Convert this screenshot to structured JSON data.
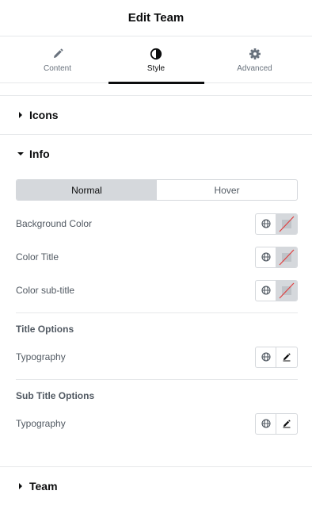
{
  "header": {
    "title": "Edit Team"
  },
  "tabs": [
    {
      "label": "Content",
      "icon": "pencil-icon",
      "active": false
    },
    {
      "label": "Style",
      "icon": "contrast-icon",
      "active": true
    },
    {
      "label": "Advanced",
      "icon": "gear-icon",
      "active": false
    }
  ],
  "sections": {
    "icons": {
      "title": "Icons",
      "expanded": false
    },
    "info": {
      "title": "Info",
      "expanded": true
    },
    "team": {
      "title": "Team",
      "expanded": false
    }
  },
  "state_toggle": {
    "normal": "Normal",
    "hover": "Hover",
    "selected": "Normal"
  },
  "colors": [
    {
      "label": "Background Color",
      "value": ""
    },
    {
      "label": "Color Title",
      "value": ""
    },
    {
      "label": "Color sub-title",
      "value": ""
    }
  ],
  "title_options": {
    "heading": "Title Options",
    "typography_label": "Typography"
  },
  "subtitle_options": {
    "heading": "Sub Title Options",
    "typography_label": "Typography"
  },
  "theme": {
    "text_dark": "#0c0d0e",
    "text": "#515962",
    "border": "#d5d8dc",
    "clear_slash": "#e04040"
  }
}
